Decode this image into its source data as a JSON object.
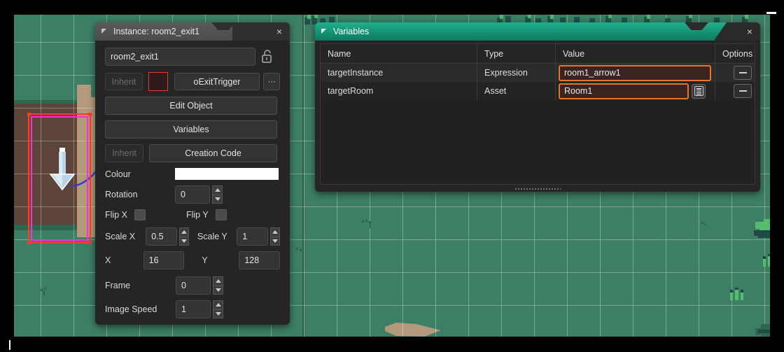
{
  "room_editor": {
    "background_color": "#3d7f64",
    "grid_color": "#ffffff",
    "selection_color": "#ff3b30",
    "selection_inner_color": "#ff2fd1",
    "selected_instance_sprite": "down-arrow-sprite"
  },
  "instance_panel": {
    "title": "Instance: room2_exit1",
    "close_label": "×",
    "name_value": "room2_exit1",
    "lock_icon": "unlocked-padlock-icon",
    "inherit_label": "Inherit",
    "object_name": "oExitTrigger",
    "more_label": "···",
    "edit_object_label": "Edit Object",
    "variables_label": "Variables",
    "inherit_creation_label": "Inherit",
    "creation_code_label": "Creation Code",
    "colour_label": "Colour",
    "colour_value": "#ffffff",
    "rotation_label": "Rotation",
    "rotation_value": "0",
    "flip_x_label": "Flip X",
    "flip_x_checked": false,
    "flip_y_label": "Flip Y",
    "flip_y_checked": false,
    "scale_x_label": "Scale X",
    "scale_x_value": "0.5",
    "scale_y_label": "Scale Y",
    "scale_y_value": "1",
    "x_label": "X",
    "x_value": "16",
    "y_label": "Y",
    "y_value": "128",
    "frame_label": "Frame",
    "frame_value": "0",
    "image_speed_label": "Image Speed",
    "image_speed_value": "1"
  },
  "variables_panel": {
    "title": "Variables",
    "close_label": "×",
    "accent_color": "#0d7a5f",
    "edit_highlight_color": "#e8732a",
    "columns": [
      "Name",
      "Type",
      "Value",
      "Options"
    ],
    "rows": [
      {
        "name": "targetInstance",
        "type": "Expression",
        "value": "room1_arrow1",
        "has_picker": false,
        "remove_label": "−"
      },
      {
        "name": "targetRoom",
        "type": "Asset",
        "value": "Room1",
        "has_picker": true,
        "picker_icon": "asset-list-icon",
        "remove_label": "−"
      }
    ]
  }
}
